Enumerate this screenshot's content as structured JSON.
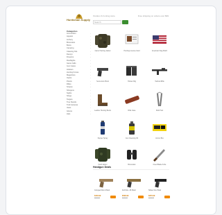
{
  "header": {
    "logo_text": "Huntsman Supply",
    "tagline": "Outdoor & hunting store",
    "contact": "Free shipping on orders over $99",
    "search_placeholder": "Search"
  },
  "sidebar": {
    "title": "Categories",
    "items": [
      "Ammunition",
      "Apparel",
      "Archery",
      "Binoculars",
      "Boots",
      "Camping",
      "Cleaning Kits",
      "Decoys",
      "Firearms",
      "Flashlights",
      "Game Calls",
      "Gun Cases",
      "Holsters",
      "Hunting Knives",
      "Magazines",
      "Optics",
      "Pistols",
      "Rifles",
      "Scopes",
      "Shotguns",
      "Sights",
      "Slings",
      "Targets",
      "Tree Stands",
      "Trail Cameras",
      "Vests",
      "Gloves",
      "Hats"
    ]
  },
  "featured_products": [
    {
      "name": "Camo Hunting Jacket",
      "image": "jacket"
    },
    {
      "name": "Hunting License Card",
      "image": "card"
    },
    {
      "name": "American Flag Patch",
      "image": "flag"
    },
    {
      "name": "Semi-Auto Pistol",
      "image": "pistol"
    },
    {
      "name": "Holster Rig",
      "image": "holster"
    },
    {
      "name": "Tactical Rifle",
      "image": "rifle"
    },
    {
      "name": "Leather Hunting Boots",
      "image": "boots"
    },
    {
      "name": "Rifle Case",
      "image": "case"
    },
    {
      "name": "Multi Tool",
      "image": "multitool"
    },
    {
      "name": "Pepper Spray",
      "image": "spray"
    },
    {
      "name": "Gun Cleaning Oil",
      "image": "oil"
    },
    {
      "name": "Ammo Box",
      "image": "ammo"
    },
    {
      "name": "Field Jacket",
      "image": "jacket2"
    },
    {
      "name": "Binoculars",
      "image": "binoculars"
    },
    {
      "name": "Fixed Blade Knife",
      "image": "knife"
    }
  ],
  "deals_section": {
    "title": "Handgun Deals"
  },
  "deals": [
    {
      "name": "Compact 9mm Pistol",
      "price": "$449.99",
      "old_price": "$529.99",
      "image": "pistol-tan"
    },
    {
      "name": "Full Size .45 Pistol",
      "price": "$599.99",
      "old_price": "$679.99",
      "image": "pistol-tan2"
    },
    {
      "name": "Striker Fire Pistol",
      "price": "$379.99",
      "old_price": "$449.99",
      "image": "pistol-black"
    }
  ],
  "colors": {
    "accent_orange": "#f08a00",
    "search_green": "#3a8d2f",
    "logo_gold": "#8a6a18"
  }
}
